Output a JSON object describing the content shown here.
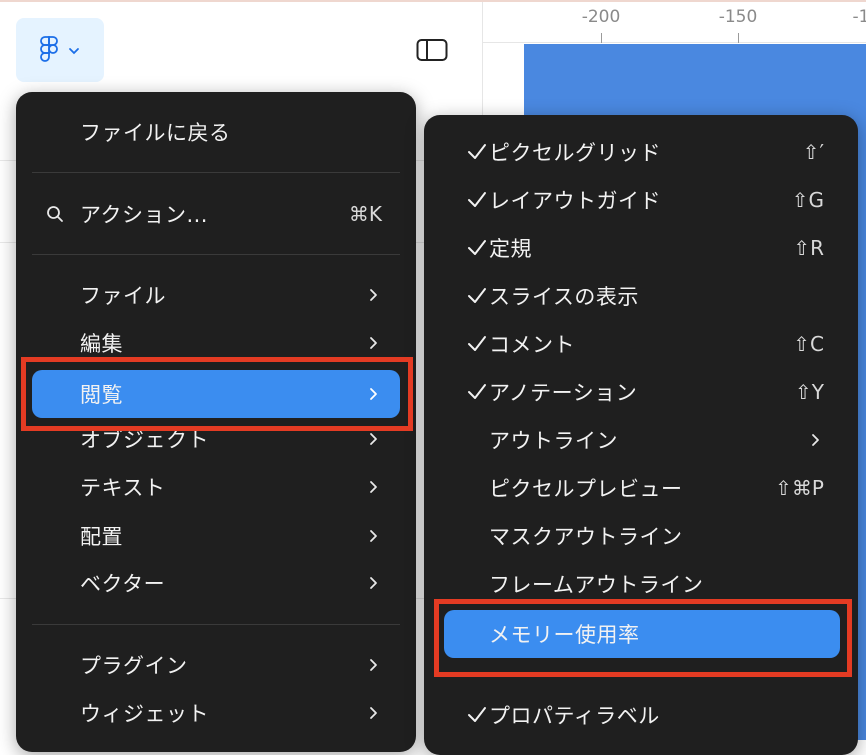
{
  "ruler": {
    "labels": [
      "-200",
      "-150",
      "-1"
    ]
  },
  "main_menu": {
    "back_to_files": "ファイルに戻る",
    "actions": {
      "label": "アクション...",
      "shortcut": "⌘K"
    },
    "items": [
      {
        "label": "ファイル"
      },
      {
        "label": "編集"
      },
      {
        "label": "閲覧"
      },
      {
        "label": "オブジェクト"
      },
      {
        "label": "テキスト"
      },
      {
        "label": "配置"
      },
      {
        "label": "ベクター"
      }
    ],
    "items2": [
      {
        "label": "プラグイン"
      },
      {
        "label": "ウィジェット"
      }
    ]
  },
  "view_submenu": {
    "items": [
      {
        "label": "ピクセルグリッド",
        "checked": true,
        "shortcut": "⇧′"
      },
      {
        "label": "レイアウトガイド",
        "checked": true,
        "shortcut": "⇧G"
      },
      {
        "label": "定規",
        "checked": true,
        "shortcut": "⇧R"
      },
      {
        "label": "スライスの表示",
        "checked": true,
        "shortcut": ""
      },
      {
        "label": "コメント",
        "checked": true,
        "shortcut": "⇧C"
      },
      {
        "label": "アノテーション",
        "checked": true,
        "shortcut": "⇧Y"
      },
      {
        "label": "アウトライン",
        "checked": false,
        "shortcut": ""
      },
      {
        "label": "ピクセルプレビュー",
        "checked": false,
        "shortcut": "⇧⌘P"
      },
      {
        "label": "マスクアウトライン",
        "checked": false,
        "shortcut": ""
      },
      {
        "label": "フレームアウトライン",
        "checked": false,
        "shortcut": ""
      },
      {
        "label": "メモリー使用率",
        "checked": false,
        "shortcut": ""
      },
      {
        "label": "プロパティラベル",
        "checked": true,
        "shortcut": ""
      }
    ]
  },
  "colors": {
    "menu_bg": "#1f1f1f",
    "accent": "#3b8df0",
    "highlight": "#e43b23",
    "canvas_frame": "#4a88e0"
  }
}
